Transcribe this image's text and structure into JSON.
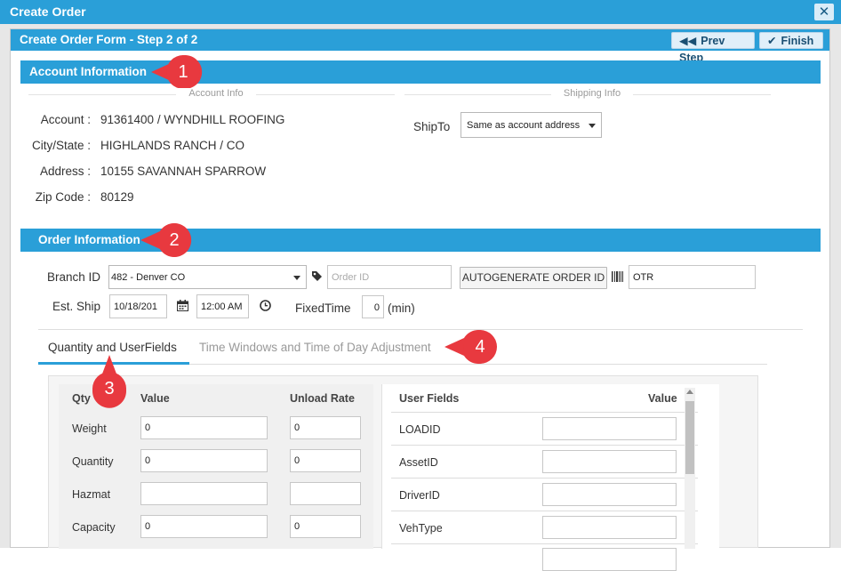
{
  "dialog": {
    "title": "Create Order",
    "close_icon": "close-icon"
  },
  "form": {
    "title": "Create Order Form - Step 2 of 2",
    "prev_label": "Prev Step",
    "finish_label": "Finish"
  },
  "account_section": {
    "title": "Account Information",
    "account_info_legend": "Account Info",
    "shipping_info_legend": "Shipping Info",
    "fields": [
      {
        "label": "Account :",
        "value": "91361400 / WYNDHILL ROOFING"
      },
      {
        "label": "City/State :",
        "value": "HIGHLANDS RANCH / CO"
      },
      {
        "label": "Address :",
        "value": "10155 SAVANNAH SPARROW"
      },
      {
        "label": "Zip Code :",
        "value": "80129"
      }
    ],
    "shipto_label": "ShipTo",
    "shipto_value": "Same as account address"
  },
  "order_section": {
    "title": "Order Information",
    "branch_label": "Branch ID",
    "branch_value": "482 - Denver CO",
    "order_id_placeholder": "Order ID",
    "autogenerate_label": "AUTOGENERATE ORDER ID",
    "barcode_value": "OTR",
    "est_ship_label": "Est. Ship",
    "est_ship_date": "10/18/201",
    "est_ship_time": "12:00 AM",
    "fixed_time_label": "FixedTime",
    "fixed_time_value": "0",
    "fixed_time_unit": "(min)"
  },
  "tabs": [
    {
      "label": "Quantity and UserFields"
    },
    {
      "label": "Time Windows and Time of Day Adjustment"
    }
  ],
  "quantity_grid": {
    "headers": {
      "qty": "Qty",
      "value": "Value",
      "unload_rate": "Unload Rate"
    },
    "rows": [
      {
        "label": "Weight",
        "value": "0",
        "unload": "0"
      },
      {
        "label": "Quantity",
        "value": "0",
        "unload": "0"
      },
      {
        "label": "Hazmat",
        "value": "",
        "unload": ""
      },
      {
        "label": "Capacity",
        "value": "0",
        "unload": "0"
      }
    ]
  },
  "user_fields": {
    "headers": {
      "name": "User Fields",
      "value": "Value"
    },
    "rows": [
      {
        "label": "LOADID",
        "value": ""
      },
      {
        "label": "AssetID",
        "value": ""
      },
      {
        "label": "DriverID",
        "value": ""
      },
      {
        "label": "VehType",
        "value": ""
      }
    ]
  },
  "callouts": [
    "1",
    "2",
    "3",
    "4"
  ],
  "colors": {
    "accent": "#2a9fd8",
    "callout": "#e8393f"
  }
}
